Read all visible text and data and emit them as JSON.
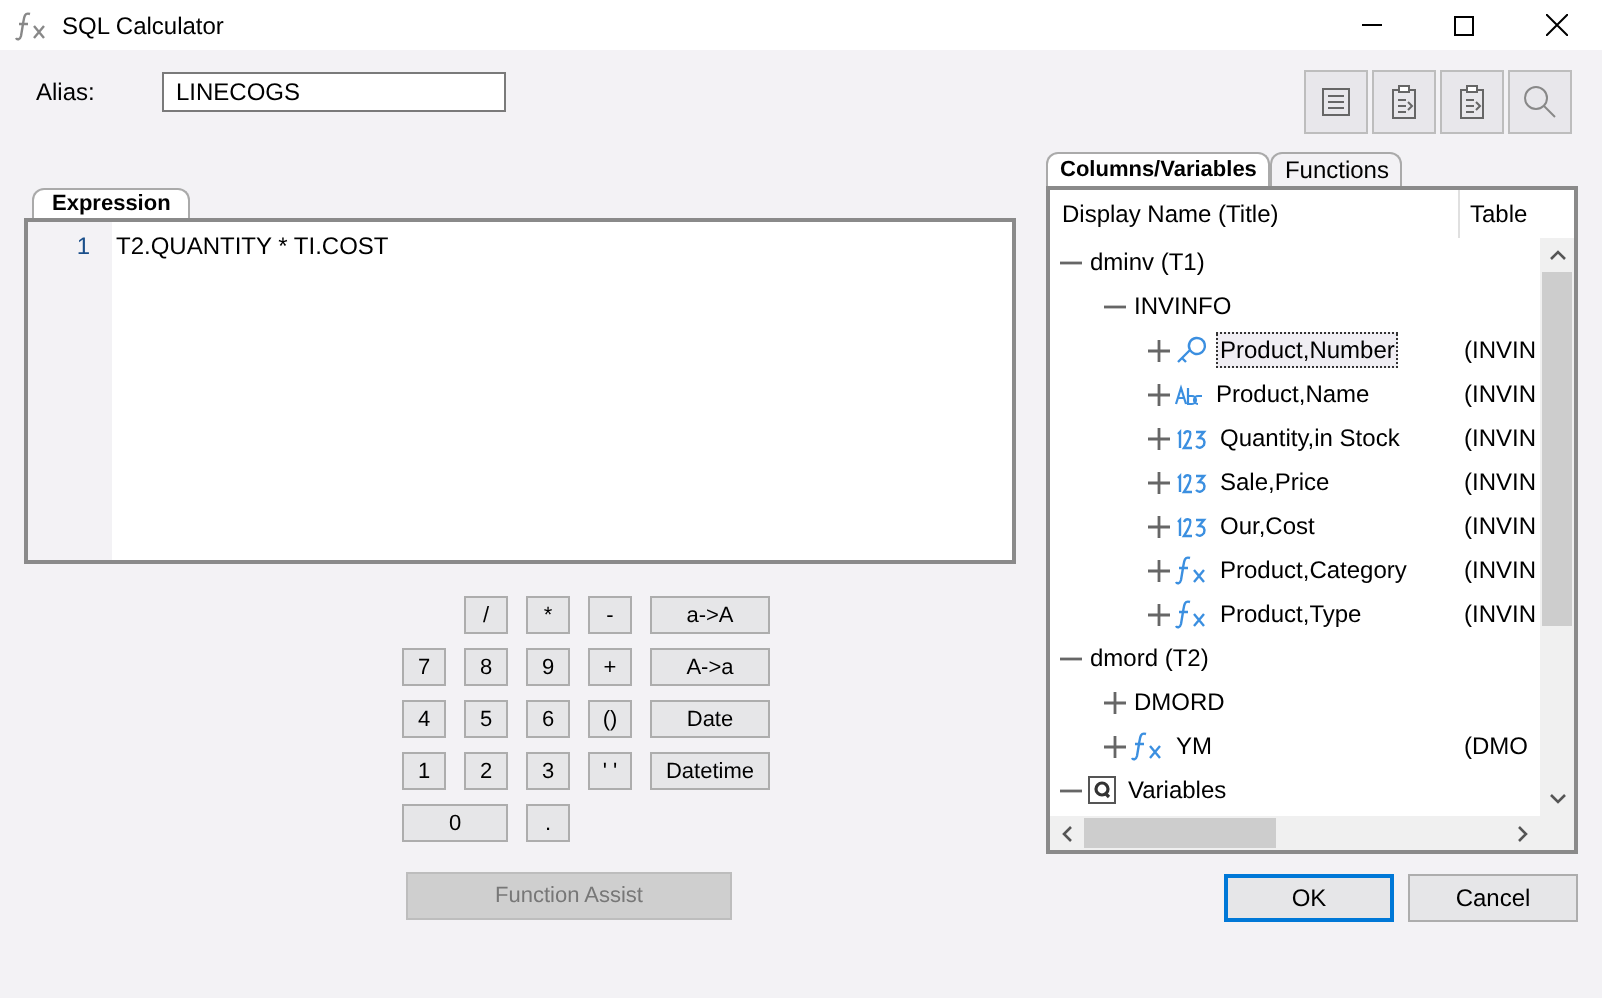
{
  "window": {
    "title": "SQL Calculator"
  },
  "alias": {
    "label": "Alias:",
    "value": "LINECOGS"
  },
  "toolbar": [
    {
      "kind": "list"
    },
    {
      "kind": "clipboard"
    },
    {
      "kind": "clipboard"
    },
    {
      "kind": "search"
    }
  ],
  "expression": {
    "tab": "Expression",
    "lines": [
      {
        "number": "1",
        "text": "T2.QUANTITY * TI.COST"
      }
    ]
  },
  "keypad": {
    "rows": [
      [
        {
          "kind": "blank"
        },
        {
          "label": "/",
          "kind": "key"
        },
        {
          "label": "*",
          "kind": "key"
        },
        {
          "label": "-",
          "kind": "key"
        },
        {
          "label": "a->A",
          "kind": "wide"
        }
      ],
      [
        {
          "label": "7",
          "kind": "key"
        },
        {
          "label": "8",
          "kind": "key"
        },
        {
          "label": "9",
          "kind": "key"
        },
        {
          "label": "+",
          "kind": "key"
        },
        {
          "label": "A->a",
          "kind": "wide"
        }
      ],
      [
        {
          "label": "4",
          "kind": "key"
        },
        {
          "label": "5",
          "kind": "key"
        },
        {
          "label": "6",
          "kind": "key"
        },
        {
          "label": "()",
          "kind": "key"
        },
        {
          "label": "Date",
          "kind": "wide"
        }
      ],
      [
        {
          "label": "1",
          "kind": "key"
        },
        {
          "label": "2",
          "kind": "key"
        },
        {
          "label": "3",
          "kind": "key"
        },
        {
          "label": "' '",
          "kind": "key"
        },
        {
          "label": "Datetime",
          "kind": "wide"
        }
      ],
      [
        {
          "label": "0",
          "kind": "key",
          "colspan": 2
        },
        {
          "label": ".",
          "kind": "key"
        }
      ]
    ]
  },
  "function_assist": {
    "label": "Function Assist",
    "disabled": true
  },
  "tabs": [
    {
      "label": "Columns/Variables",
      "selected": true
    },
    {
      "label": "Functions",
      "selected": false
    }
  ],
  "tree": {
    "columns": [
      "Display Name (Title)",
      "Table"
    ],
    "items": [
      {
        "label": "dminv (T1)",
        "expanded": true,
        "selected": false,
        "children": [
          {
            "label": "INVINFO",
            "expanded": true,
            "selected": false,
            "children": [
              {
                "label": "Product,Number",
                "kind": "key",
                "table": "(INVIN",
                "expanded": false,
                "selected": true
              },
              {
                "label": "Product,Name",
                "kind": "abc",
                "table": "(INVIN",
                "expanded": false,
                "selected": false
              },
              {
                "label": "Quantity,in Stock",
                "kind": "number",
                "table": "(INVIN",
                "expanded": false,
                "selected": false
              },
              {
                "label": "Sale,Price",
                "kind": "number",
                "table": "(INVIN",
                "expanded": false,
                "selected": false
              },
              {
                "label": "Our,Cost",
                "kind": "number",
                "table": "(INVIN",
                "expanded": false,
                "selected": false
              },
              {
                "label": "Product,Category",
                "kind": "function",
                "table": "(INVIN",
                "expanded": false,
                "selected": false
              },
              {
                "label": "Product,Type",
                "kind": "function",
                "table": "(INVIN",
                "expanded": false,
                "selected": false
              }
            ]
          }
        ]
      },
      {
        "label": "dmord (T2)",
        "expanded": true,
        "selected": false,
        "children": [
          {
            "label": "DMORD",
            "expanded": false,
            "selected": false
          },
          {
            "label": "YM",
            "kind": "function",
            "table": "(DMO",
            "expanded": false,
            "selected": false
          }
        ]
      },
      {
        "label": "Variables",
        "kind": "query",
        "expanded": true,
        "selected": false
      }
    ]
  },
  "buttons": [
    {
      "label": "OK",
      "default": true
    },
    {
      "label": "Cancel",
      "default": false
    }
  ]
}
